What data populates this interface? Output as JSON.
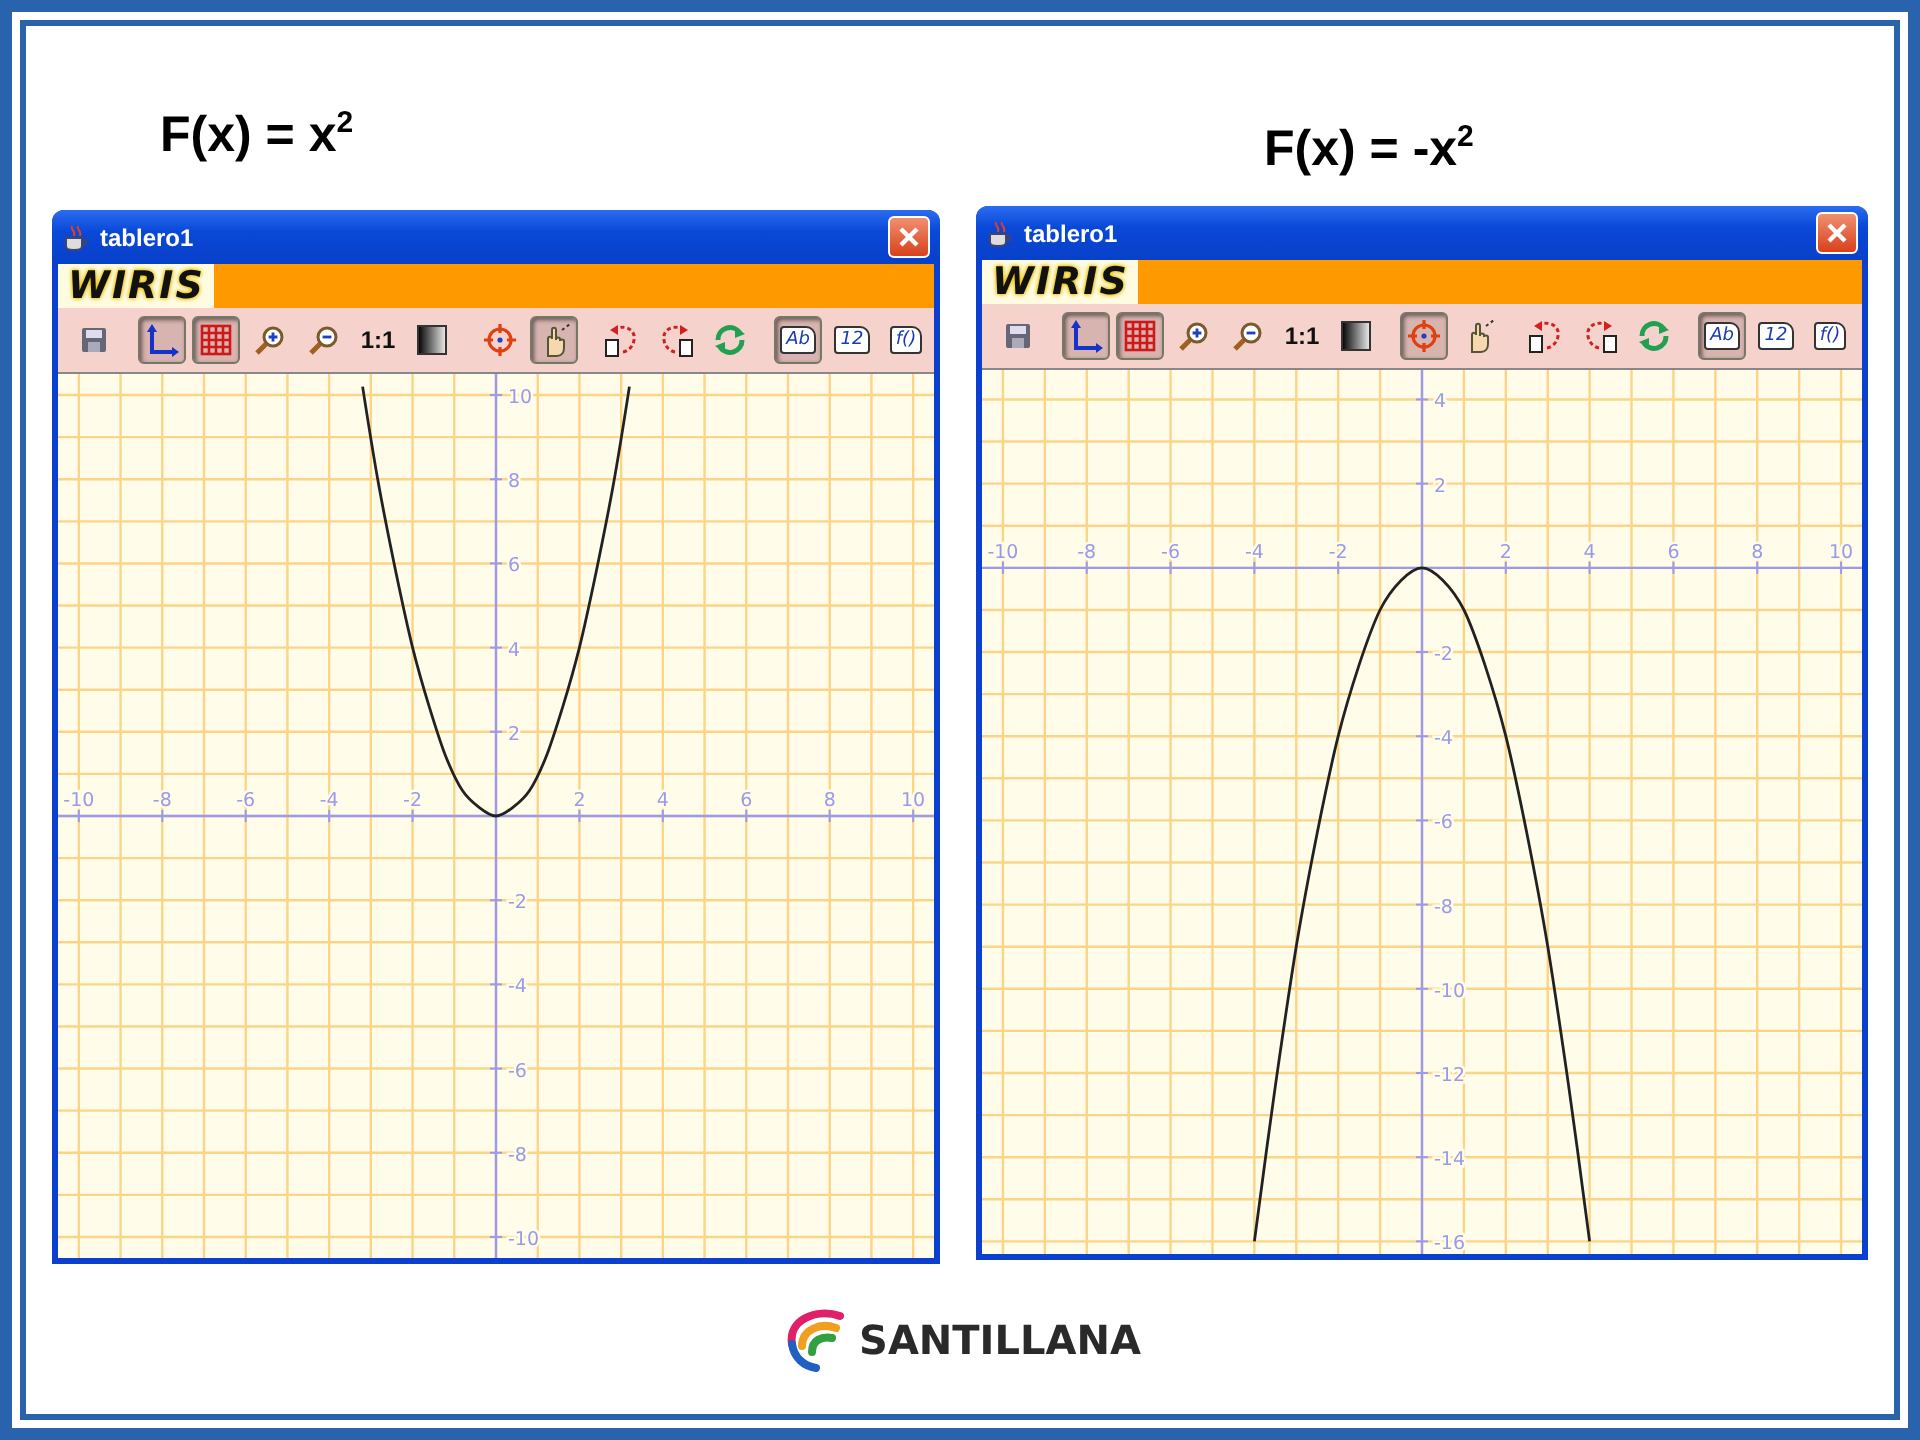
{
  "titles": [
    {
      "text": "F(x) = x$^{2}$"
    },
    {
      "text": "F(x) = -x$^{2}$"
    }
  ],
  "windows": [
    {
      "title": "tablero1",
      "logo": "WIRIS",
      "toolbar_groups": [
        {
          "tools": [
            {
              "kind": "save",
              "selected": false
            }
          ]
        },
        {
          "tools": [
            {
              "kind": "axes",
              "selected": true
            },
            {
              "kind": "grid",
              "selected": true
            },
            {
              "kind": "zoom-in",
              "selected": false
            },
            {
              "kind": "zoom-out",
              "selected": false
            },
            {
              "kind": "text",
              "label": "1:1",
              "selected": false
            },
            {
              "kind": "gradient",
              "selected": false
            }
          ]
        },
        {
          "tools": [
            {
              "kind": "target",
              "selected": false
            },
            {
              "kind": "hand",
              "selected": true
            }
          ]
        },
        {
          "tools": [
            {
              "kind": "rotate-left",
              "selected": false
            },
            {
              "kind": "rotate-right",
              "selected": false
            },
            {
              "kind": "refresh",
              "selected": false
            }
          ]
        },
        {
          "tools": [
            {
              "kind": "page",
              "label": "Ab",
              "selected": true
            },
            {
              "kind": "page",
              "label": "12",
              "selected": false
            },
            {
              "kind": "page",
              "label": "f()",
              "selected": false
            }
          ]
        }
      ],
      "chart_data": {
        "type": "line",
        "grid": true,
        "x": [
          -3.2,
          -2.8,
          -2.4,
          -2,
          -1.6,
          -1.2,
          -0.8,
          -0.4,
          0,
          0.4,
          0.8,
          1.2,
          1.6,
          2,
          2.4,
          2.8,
          3.2
        ],
        "series": [
          {
            "color": "#222222",
            "values": [
              10.2,
              7.8,
              5.8,
              4,
              2.6,
              1.4,
              0.6,
              0.2,
              0,
              0.2,
              0.6,
              1.4,
              2.6,
              4,
              5.8,
              7.8,
              10.2
            ]
          }
        ],
        "xlim": [
          -10.5,
          10.5
        ],
        "ylim": [
          -10.5,
          10.5
        ],
        "xticks": [
          -10,
          -8,
          -6,
          -4,
          -2,
          2,
          4,
          6,
          8,
          10
        ],
        "yticks": [
          -10,
          -8,
          -6,
          -4,
          -2,
          2,
          4,
          6,
          8,
          10
        ]
      }
    },
    {
      "title": "tablero1",
      "logo": "WIRIS",
      "toolbar_groups": [
        {
          "tools": [
            {
              "kind": "save",
              "selected": false
            }
          ]
        },
        {
          "tools": [
            {
              "kind": "axes",
              "selected": true
            },
            {
              "kind": "grid",
              "selected": true
            },
            {
              "kind": "zoom-in",
              "selected": false
            },
            {
              "kind": "zoom-out",
              "selected": false
            },
            {
              "kind": "text",
              "label": "1:1",
              "selected": false
            },
            {
              "kind": "gradient",
              "selected": false
            }
          ]
        },
        {
          "tools": [
            {
              "kind": "target",
              "selected": true
            },
            {
              "kind": "hand",
              "selected": false
            }
          ]
        },
        {
          "tools": [
            {
              "kind": "rotate-left",
              "selected": false
            },
            {
              "kind": "rotate-right",
              "selected": false
            },
            {
              "kind": "refresh",
              "selected": false
            }
          ]
        },
        {
          "tools": [
            {
              "kind": "page",
              "label": "Ab",
              "selected": true
            },
            {
              "kind": "page",
              "label": "12",
              "selected": false
            },
            {
              "kind": "page",
              "label": "f()",
              "selected": false
            }
          ]
        }
      ],
      "chart_data": {
        "type": "line",
        "grid": true,
        "x": [
          -4,
          -3.5,
          -3,
          -2.5,
          -2,
          -1.5,
          -1,
          -0.5,
          0,
          0.5,
          1,
          1.5,
          2,
          2.5,
          3,
          3.5,
          4
        ],
        "series": [
          {
            "color": "#222222",
            "values": [
              -16,
              -12.3,
              -9,
              -6.3,
              -4,
              -2.3,
              -1,
              -0.3,
              0,
              -0.3,
              -1,
              -2.3,
              -4,
              -6.3,
              -9,
              -12.3,
              -16
            ]
          }
        ],
        "xlim": [
          -10.5,
          10.5
        ],
        "ylim": [
          -16.3,
          4.7
        ],
        "xticks": [
          -10,
          -8,
          -6,
          -4,
          -2,
          2,
          4,
          6,
          8,
          10
        ],
        "yticks": [
          -16,
          -14,
          -12,
          -10,
          -8,
          -6,
          -4,
          -2,
          2,
          4
        ]
      }
    }
  ],
  "brand": {
    "name": "SANTILLANA"
  }
}
